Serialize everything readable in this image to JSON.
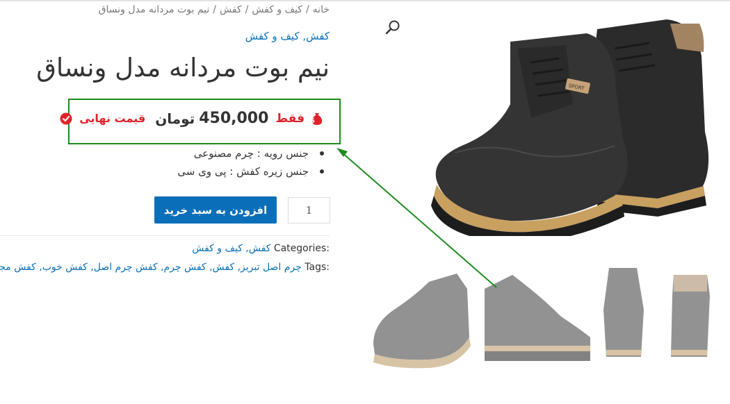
{
  "breadcrumb": {
    "home": "خانه",
    "separator": "/",
    "level1": "کیف و کفش",
    "level2": "کفش",
    "current": "نیم بوت مردانه مدل ونساق"
  },
  "top_category": {
    "link1": "کفش",
    "comma": ",",
    "link2": "کیف و کفش"
  },
  "product": {
    "title": "نیم بوت مردانه مدل ونساق"
  },
  "price": {
    "prefix": "فقط",
    "amount": "450,000",
    "currency": "تومان",
    "final_label": "قیمت نهایی",
    "accent_color": "#e0232a",
    "box_color": "#1e8a1e"
  },
  "specs": [
    "جنس رویه : چرم مصنوعی",
    "جنس زیره کفش : پی وی سی"
  ],
  "cart": {
    "quantity": "1",
    "add_label": "افزودن به سبد خرید",
    "button_color": "#0a6fb8"
  },
  "meta": {
    "categories_label": "Categories:",
    "categories_value": "کفش, کیف و کفش",
    "tags_label": "Tags:",
    "tags_value": "چرم اصل تبریز, کفش, کفش چرم, کفش چرم اصل, کفش خوب, کفش مجلسی"
  },
  "icons": {
    "search": "search-icon",
    "money": "money-bag-icon",
    "check": "check-circle-icon"
  }
}
